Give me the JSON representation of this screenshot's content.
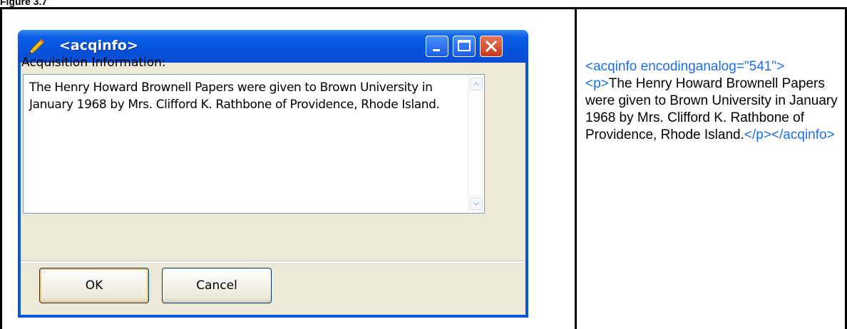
{
  "figure": {
    "title": "Figure 3.7"
  },
  "dialog": {
    "title": "<acqinfo>",
    "label": "Acquisition Information:",
    "text": "The Henry Howard Brownell Papers were given to Brown University in January 1968 by Mrs. Clifford K. Rathbone of Providence, Rhode Island.",
    "ok_label": "OK",
    "cancel_label": "Cancel",
    "icon": "pencil-icon"
  },
  "code": {
    "open_tag": "<acqinfo encodinganalog=\"541\">",
    "p_open": "<p>",
    "text": "The Henry Howard Brownell Papers were given to Brown University in January 1968 by Mrs. Clifford K. Rathbone of Providence, Rhode Island.",
    "close_tags": "</p></acqinfo>"
  },
  "colors": {
    "titlebar": "#0a5fe3",
    "close_button": "#c8391c",
    "tag": "#1e6ee8"
  }
}
